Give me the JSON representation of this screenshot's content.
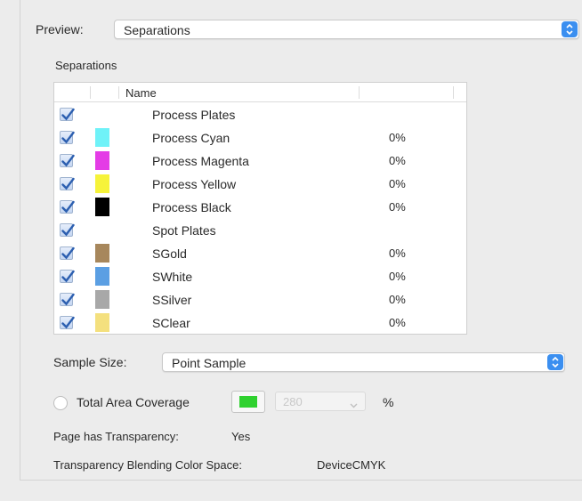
{
  "preview": {
    "label": "Preview:",
    "value": "Separations"
  },
  "separations_section": {
    "label": "Separations"
  },
  "table": {
    "header_name": "Name",
    "rows": [
      {
        "name": "Process Plates",
        "percent": "",
        "swatch": ""
      },
      {
        "name": "Process Cyan",
        "percent": "0%",
        "swatch": "#6ff2f8"
      },
      {
        "name": "Process Magenta",
        "percent": "0%",
        "swatch": "#e43ce6"
      },
      {
        "name": "Process Yellow",
        "percent": "0%",
        "swatch": "#f6f33a"
      },
      {
        "name": "Process Black",
        "percent": "0%",
        "swatch": "#000000"
      },
      {
        "name": "Spot Plates",
        "percent": "",
        "swatch": ""
      },
      {
        "name": "SGold",
        "percent": "0%",
        "swatch": "#a7875c"
      },
      {
        "name": "SWhite",
        "percent": "0%",
        "swatch": "#5b9fe3"
      },
      {
        "name": "SSilver",
        "percent": "0%",
        "swatch": "#a8a8a8"
      },
      {
        "name": "SClear",
        "percent": "0%",
        "swatch": "#f4e07e"
      }
    ]
  },
  "sample_size": {
    "label": "Sample Size:",
    "value": "Point Sample"
  },
  "total_area_coverage": {
    "label": "Total Area Coverage",
    "checked": false,
    "swatch_color": "#2fd12f",
    "value": "280",
    "unit": "%"
  },
  "transparency": {
    "label": "Page has Transparency:",
    "value": "Yes"
  },
  "blending_space": {
    "label": "Transparency Blending Color Space:",
    "value": "DeviceCMYK"
  },
  "colors": {
    "accent": "#3b8ff0"
  }
}
